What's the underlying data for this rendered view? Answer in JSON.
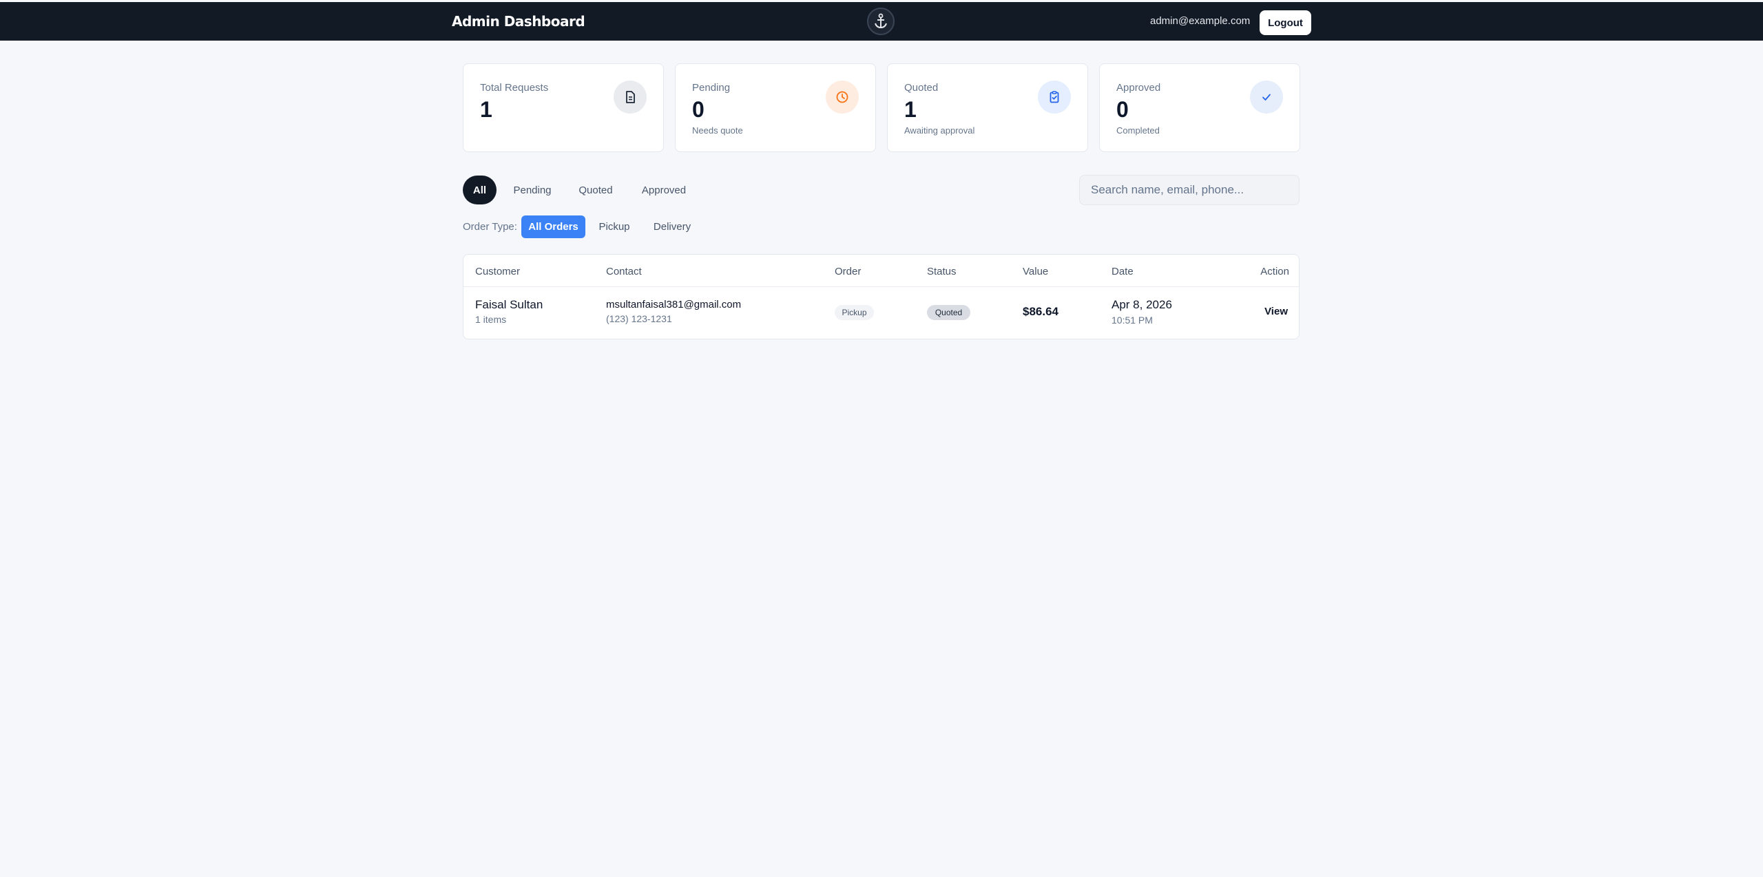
{
  "header": {
    "title": "Admin Dashboard",
    "user_email": "admin@example.com",
    "logout_label": "Logout"
  },
  "stats": [
    {
      "label": "Total Requests",
      "value": "1",
      "sub": "",
      "icon": "document-icon",
      "icon_bg": "#e9ebef",
      "icon_color": "#1f2937"
    },
    {
      "label": "Pending",
      "value": "0",
      "sub": "Needs quote",
      "icon": "clock-icon",
      "icon_bg": "#ffece0",
      "icon_color": "#f97316"
    },
    {
      "label": "Quoted",
      "value": "1",
      "sub": "Awaiting approval",
      "icon": "clipboard-check-icon",
      "icon_bg": "#e4eefe",
      "icon_color": "#2563eb"
    },
    {
      "label": "Approved",
      "value": "0",
      "sub": "Completed",
      "icon": "check-icon",
      "icon_bg": "#e6eefc",
      "icon_color": "#2563eb"
    }
  ],
  "tabs": [
    {
      "label": "All",
      "active": true
    },
    {
      "label": "Pending",
      "active": false
    },
    {
      "label": "Quoted",
      "active": false
    },
    {
      "label": "Approved",
      "active": false
    }
  ],
  "search": {
    "placeholder": "Search name, email, phone...",
    "value": ""
  },
  "order_type": {
    "label": "Order Type:",
    "options": [
      {
        "label": "All Orders",
        "active": true
      },
      {
        "label": "Pickup",
        "active": false
      },
      {
        "label": "Delivery",
        "active": false
      }
    ]
  },
  "table": {
    "columns": [
      "Customer",
      "Contact",
      "Order",
      "Status",
      "Value",
      "Date",
      "Action"
    ],
    "rows": [
      {
        "customer_name": "Faisal Sultan",
        "items": "1 items",
        "email": "msultanfaisal381@gmail.com",
        "phone": "(123) 123-1231",
        "order_type": "Pickup",
        "status": "Quoted",
        "value": "$86.64",
        "date": "Apr 8, 2026",
        "time": "10:51 PM",
        "action": "View"
      }
    ]
  },
  "colors": {
    "topbar": "#121a26",
    "accent": "#3b82f6",
    "background": "#f6f7fb"
  }
}
